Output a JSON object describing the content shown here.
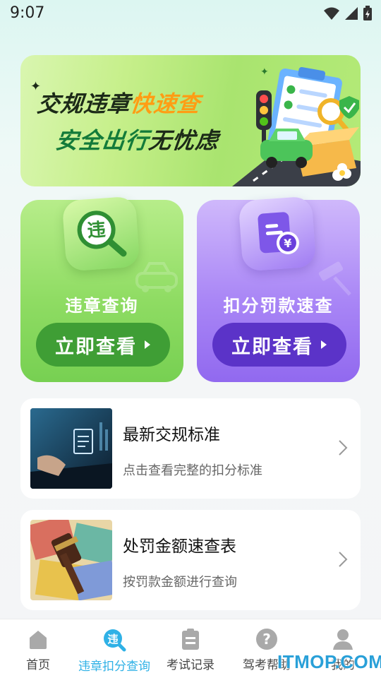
{
  "status_bar": {
    "time": "9:07"
  },
  "banner": {
    "line1_prefix": "交规违章",
    "line1_highlight": "快速查",
    "line2_prefix": "安全出行",
    "line2_suffix": "无忧虑"
  },
  "tiles": [
    {
      "label": "违章查询",
      "button": "立即查看",
      "icon_char": "违",
      "icon": "search-magnifier-icon",
      "color": "#3f9e35"
    },
    {
      "label": "扣分罚款速查",
      "button": "立即查看",
      "icon_char": "¥",
      "icon": "fine-document-icon",
      "color": "#5b33c8"
    }
  ],
  "cards": [
    {
      "title": "最新交规标准",
      "subtitle": "点击查看完整的扣分标准",
      "thumb": "laptop-document-image"
    },
    {
      "title": "处罚金额速查表",
      "subtitle": "按罚款金额进行查询",
      "thumb": "gavel-money-image"
    }
  ],
  "tab_bar": {
    "items": [
      {
        "label": "首页",
        "icon": "home-icon",
        "active": false
      },
      {
        "label": "违章扣分查询",
        "icon": "violation-icon",
        "icon_char": "违",
        "active": true
      },
      {
        "label": "考试记录",
        "icon": "clipboard-icon",
        "active": false
      },
      {
        "label": "驾考帮助",
        "icon": "help-icon",
        "active": false
      },
      {
        "label": "我的",
        "icon": "user-icon",
        "active": false
      }
    ],
    "active_color": "#2fb1e6"
  },
  "watermark": "ITMOP.COM"
}
